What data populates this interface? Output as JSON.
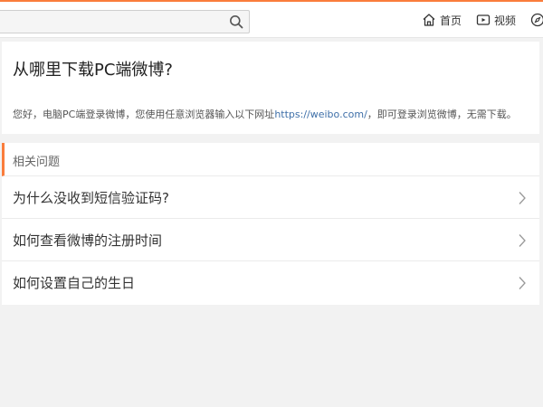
{
  "header": {
    "search_placeholder": "",
    "nav": [
      {
        "label": "首页",
        "icon": "home-icon"
      },
      {
        "label": "视频",
        "icon": "video-icon"
      }
    ]
  },
  "question": {
    "title": "从哪里下载PC端微博?",
    "answer_prefix": "您好，电脑PC端登录微博，您使用任意浏览器输入以下网址",
    "answer_link": "https://weibo.com/",
    "answer_suffix": "，即可登录浏览微博，无需下载。"
  },
  "related": {
    "title": "相关问题",
    "items": [
      {
        "label": "为什么没收到短信验证码?"
      },
      {
        "label": "如何查看微博的注册时间"
      },
      {
        "label": "如何设置自己的生日"
      }
    ]
  },
  "colors": {
    "accent": "#fa7d3c",
    "link": "#3e6fa8",
    "background": "#f2f2f2"
  }
}
